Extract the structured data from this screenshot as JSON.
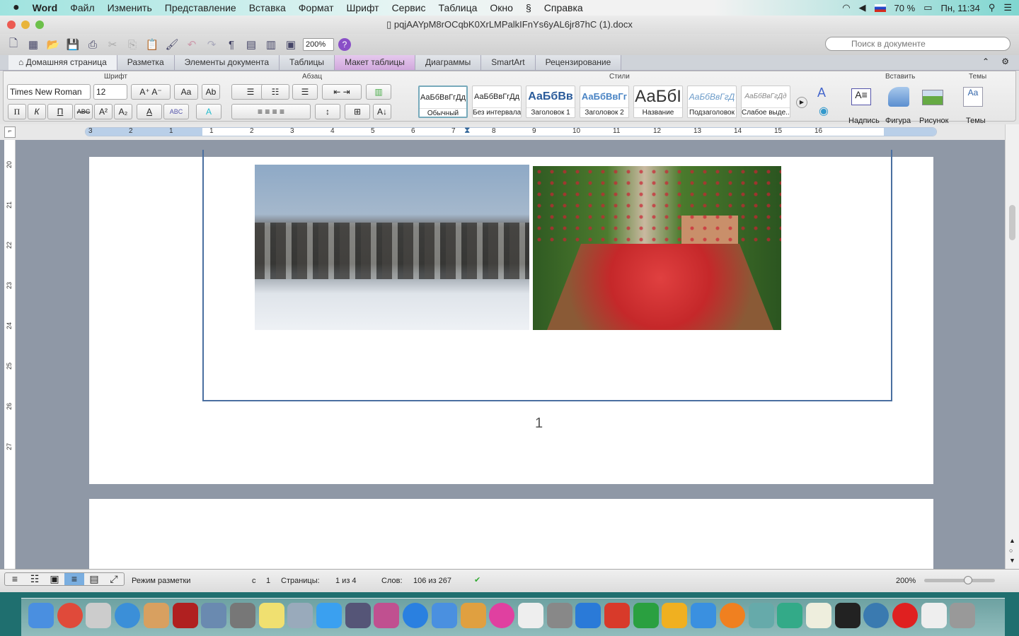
{
  "menubar": {
    "app": "Word",
    "items": [
      "Файл",
      "Изменить",
      "Представление",
      "Вставка",
      "Формат",
      "Шрифт",
      "Сервис",
      "Таблица",
      "Окно",
      "Справка"
    ],
    "battery": "70 %",
    "clock": "Пн, 11:34"
  },
  "window": {
    "title": "pqjAAYpM8rOCqbK0XrLMPalkIFnYs6yAL6jr87hC (1).docx",
    "zoom": "200%",
    "search_placeholder": "Поиск в документе"
  },
  "tabs": [
    "Домашняя страница",
    "Разметка",
    "Элементы документа",
    "Таблицы",
    "Макет таблицы",
    "Диаграммы",
    "SmartArt",
    "Рецензирование"
  ],
  "ribbon": {
    "groups": {
      "font": "Шрифт",
      "paragraph": "Абзац",
      "styles": "Стили",
      "insert": "Вставить",
      "themes": "Темы"
    },
    "font_name": "Times New Roman",
    "font_size": "12",
    "format_buttons": [
      "П",
      "К",
      "П",
      "ABC",
      "A²",
      "A₂"
    ],
    "styles": [
      {
        "preview": "АаБбВвГгДд",
        "name": "Обычный"
      },
      {
        "preview": "АаБбВвГгДд",
        "name": "Без интервала"
      },
      {
        "preview": "АаБбВв",
        "name": "Заголовок 1"
      },
      {
        "preview": "АаБбВвГг",
        "name": "Заголовок 2"
      },
      {
        "preview": "АаБбI",
        "name": "Название"
      },
      {
        "preview": "АаБбВвГгД",
        "name": "Подзаголовок"
      },
      {
        "preview": "АаБбВвГгДд",
        "name": "Слабое выде..."
      }
    ],
    "insert": [
      "Надпись",
      "Фигура",
      "Рисунок"
    ],
    "themes": "Темы"
  },
  "ruler": {
    "h_ticks": [
      "3",
      "2",
      "1",
      "1",
      "2",
      "3",
      "4",
      "5",
      "6",
      "7",
      "8",
      "9",
      "10",
      "11",
      "12",
      "13",
      "14",
      "15",
      "16"
    ],
    "v_ticks": [
      "20",
      "21",
      "22",
      "23",
      "24",
      "25",
      "26",
      "27"
    ]
  },
  "document": {
    "page_number": "1"
  },
  "statusbar": {
    "view": "Режим разметки",
    "section_label": "с",
    "section": "1",
    "pages_label": "Страницы:",
    "pages": "1 из 4",
    "words_label": "Слов:",
    "words": "106 из 267",
    "zoom": "200%"
  }
}
